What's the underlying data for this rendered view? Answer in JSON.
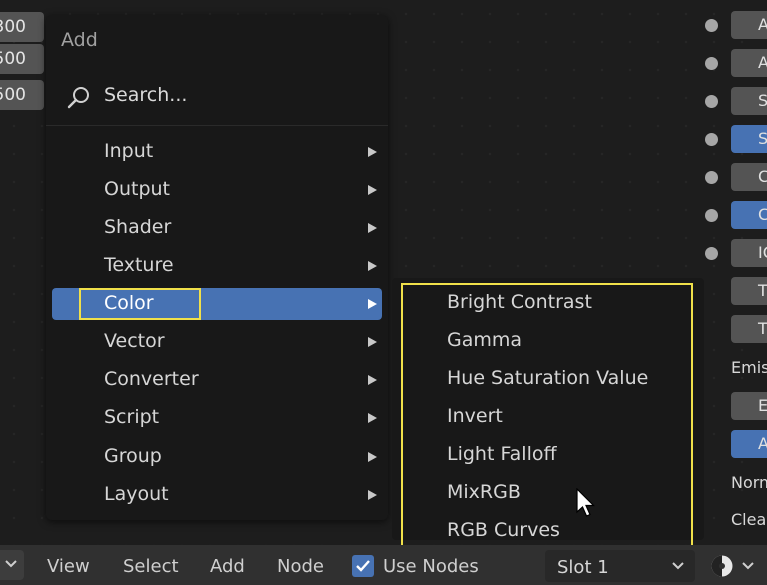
{
  "left_node": {
    "fields": [
      "300",
      "500",
      "500"
    ]
  },
  "menu": {
    "title": "Add",
    "search_placeholder": "Search...",
    "items": [
      {
        "label": "Input"
      },
      {
        "label": "Output"
      },
      {
        "label": "Shader"
      },
      {
        "label": "Texture"
      },
      {
        "label": "Color",
        "active": true
      },
      {
        "label": "Vector"
      },
      {
        "label": "Converter"
      },
      {
        "label": "Script"
      },
      {
        "label": "Group"
      },
      {
        "label": "Layout"
      }
    ]
  },
  "submenu": {
    "items": [
      "Bright Contrast",
      "Gamma",
      "Hue Saturation Value",
      "Invert",
      "Light Falloff",
      "MixRGB",
      "RGB Curves"
    ]
  },
  "right_node": {
    "buttons": [
      "A",
      "A",
      "S",
      "S",
      "C",
      "C",
      "IC",
      "T",
      "T"
    ],
    "label_emission": "Emis",
    "buttons2": [
      "E",
      "A"
    ],
    "label_normal": "Norm",
    "label_clear": "Clea"
  },
  "bottom_bar": {
    "menus": [
      "View",
      "Select",
      "Add",
      "Node"
    ],
    "use_nodes_label": "Use Nodes",
    "slot_label": "Slot 1"
  },
  "colors": {
    "accent": "#4772b3",
    "highlight": "#f0e04a",
    "menu_bg": "#181818",
    "canvas_bg": "#1d1d1d"
  }
}
